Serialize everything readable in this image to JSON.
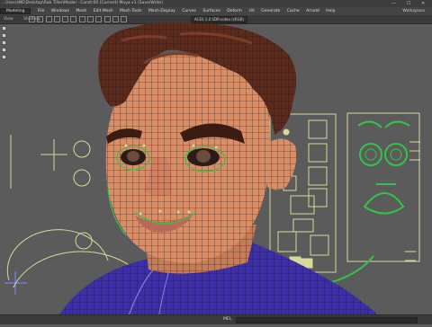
{
  "window": {
    "title": "...Users\\ME\\Desktop\\Rob Tiller\\Model - Const:00 (Current) Maya v1 (Save/Write)",
    "buttons": [
      "—",
      "☐",
      "✕"
    ]
  },
  "menubar": {
    "items": [
      "File",
      "Windows",
      "Mesh",
      "Edit Mesh",
      "Mesh Tools",
      "Mesh Display",
      "Curves",
      "Surfaces",
      "Deform",
      "UV",
      "Generate",
      "Cache",
      "Arnold",
      "Help"
    ],
    "mode": "Modeling",
    "workspace": "Workspace"
  },
  "panelbar": {
    "items": [
      "View",
      "Shading"
    ],
    "resolution": "ACES 1.0 SDR-video (sRGB)"
  },
  "statusline": {
    "mel_label": "MEL"
  },
  "colors": {
    "wireframe": "#2b1a10",
    "skin": "#d98e68",
    "shirt": "#3d2fa8",
    "hair": "#5a2a1c",
    "control_curves": "#d8d89a",
    "green_curves": "#35c248"
  },
  "icons": [
    "minimize-icon",
    "maximize-icon",
    "close-icon",
    "toolbar-icons",
    "view-tools-icon"
  ]
}
